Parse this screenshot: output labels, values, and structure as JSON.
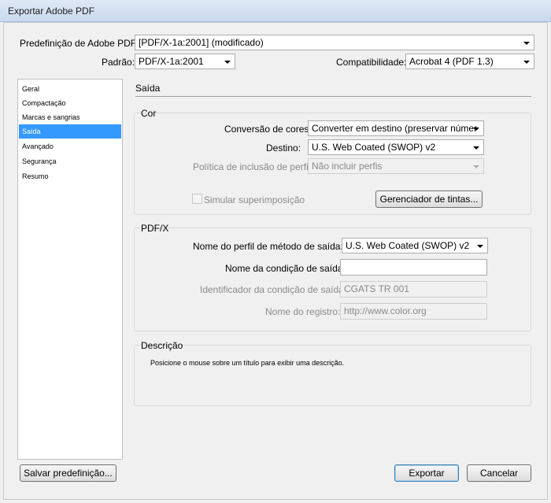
{
  "window": {
    "title": "Exportar Adobe PDF"
  },
  "preset": {
    "label": "Predefinição de Adobe PDF:",
    "value": "[PDF/X-1a:2001] (modificado)"
  },
  "standard": {
    "label": "Padrão:",
    "value": "PDF/X-1a:2001"
  },
  "compatibility": {
    "label": "Compatibilidade:",
    "value": "Acrobat 4 (PDF 1.3)"
  },
  "sidebar": {
    "items": [
      {
        "label": "Geral"
      },
      {
        "label": "Compactação"
      },
      {
        "label": "Marcas e sangrias"
      },
      {
        "label": "Saída"
      },
      {
        "label": "Avançado"
      },
      {
        "label": "Segurança"
      },
      {
        "label": "Resumo"
      }
    ],
    "selected_index": 3
  },
  "panel": {
    "title": "Saída"
  },
  "color_group": {
    "title": "Cor",
    "conversion": {
      "label": "Conversão de cores:",
      "value": "Converter em destino (preservar númer"
    },
    "destination": {
      "label": "Destino:",
      "value": "U.S. Web Coated (SWOP) v2"
    },
    "profile_policy": {
      "label": "Política de inclusão de perfil:",
      "value": "Não incluir perfis"
    },
    "simulate_overprint": {
      "label": "Simular superimposição",
      "checked": false
    },
    "ink_manager_label": "Gerenciador de tintas..."
  },
  "pdfx_group": {
    "title": "PDF/X",
    "output_intent_profile": {
      "label": "Nome do perfil de método de saída:",
      "value": "U.S. Web Coated (SWOP) v2"
    },
    "output_condition_name": {
      "label": "Nome da condição de saída:",
      "value": ""
    },
    "output_condition_identifier": {
      "label": "Identificador da condição de saída:",
      "value": "CGATS TR 001"
    },
    "registry_name": {
      "label": "Nome do registro:",
      "value": "http://www.color.org"
    }
  },
  "description_group": {
    "title": "Descrição",
    "text": "Posicione o mouse sobre um título para exibir uma descrição."
  },
  "footer": {
    "save_preset_label": "Salvar predefinição...",
    "export_label": "Exportar",
    "cancel_label": "Cancelar"
  }
}
